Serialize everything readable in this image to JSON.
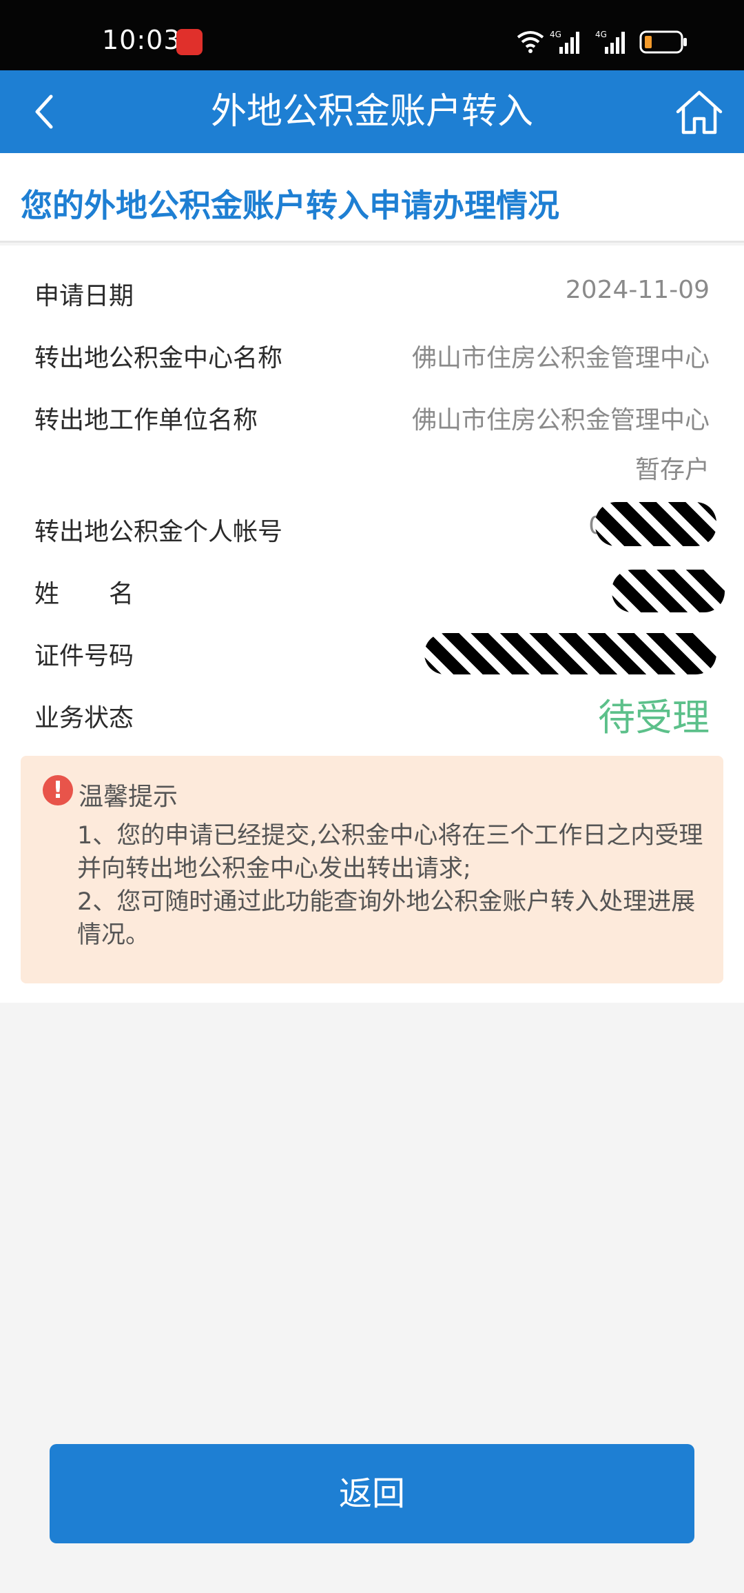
{
  "status_bar": {
    "time": "10:03",
    "network_1": "4G",
    "network_2": "4G"
  },
  "nav": {
    "title": "外地公积金账户转入",
    "back_icon": "chevron-left-icon",
    "home_icon": "home-icon"
  },
  "section": {
    "title": "您的外地公积金账户转入申请办理情况"
  },
  "details": [
    {
      "label": "申请日期",
      "value": "2024-11-09"
    },
    {
      "label": "转出地公积金中心名称",
      "value": "佛山市住房公积金管理中心"
    },
    {
      "label": "转出地工作单位名称",
      "value": "佛山市住房公积金管理中心",
      "value_line2": "暂存户"
    },
    {
      "label": "转出地公积金个人帐号",
      "value": "05"
    },
    {
      "label": "姓　　名",
      "value": ""
    },
    {
      "label": "证件号码",
      "value": ""
    },
    {
      "label": "业务状态",
      "value": "待受理"
    }
  ],
  "tips": {
    "title": "温馨提示",
    "line1": "1、您的申请已经提交,公积金中心将在三个工作日之内受理并向转出地公积金中心发出转出请求;",
    "line2": "2、您可随时通过此功能查询外地公积金账户转入处理进展情况。"
  },
  "button": {
    "return_label": "返回"
  },
  "colors": {
    "primary": "#1e7fd3",
    "status_green": "#5cc08a",
    "tips_bg": "#fdeadb",
    "alert_red": "#e8544a"
  }
}
